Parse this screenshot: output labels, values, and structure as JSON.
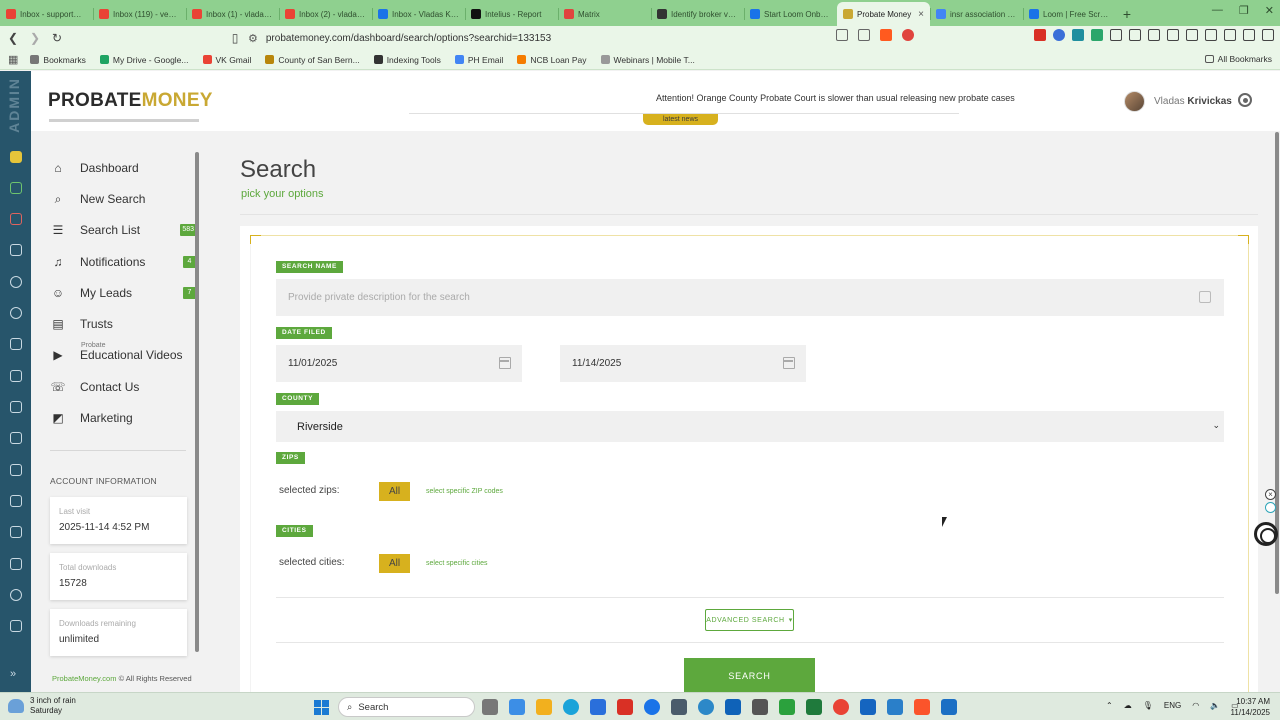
{
  "browser": {
    "tabs": [
      {
        "title": "Inbox - support@...",
        "color": "#ea4335"
      },
      {
        "title": "Inbox (119) - vee@...",
        "color": "#ea4335"
      },
      {
        "title": "Inbox (1) - vladas@...",
        "color": "#ea4335"
      },
      {
        "title": "Inbox (2) - vladas...",
        "color": "#ea4335"
      },
      {
        "title": "Inbox - Vladas Kriv...",
        "color": "#1a73e8"
      },
      {
        "title": "Intelius - Report",
        "color": "#111111"
      },
      {
        "title": "Matrix",
        "color": "#e0443e"
      },
      {
        "title": "Identify broker vs...",
        "color": "#333333"
      },
      {
        "title": "Start Loom Onboa...",
        "color": "#1a73e8"
      },
      {
        "title": "Probate Money",
        "color": "#c9a833",
        "active": true
      },
      {
        "title": "insr association of...",
        "color": "#4285f4"
      },
      {
        "title": "Loom | Free Scree...",
        "color": "#1a73e8"
      }
    ],
    "url": "probatemoney.com/dashboard/search/options?searchid=133153",
    "bookmarks": [
      {
        "label": "Bookmarks",
        "color": "#777777"
      },
      {
        "label": "My Drive - Google...",
        "color": "#1fa463"
      },
      {
        "label": "VK Gmail",
        "color": "#ea4335"
      },
      {
        "label": "County of San Bern...",
        "color": "#b8860b"
      },
      {
        "label": "Indexing Tools",
        "color": "#333333"
      },
      {
        "label": "PH Email",
        "color": "#4285f4"
      },
      {
        "label": "NCB Loan Pay",
        "color": "#f57c00"
      },
      {
        "label": "Webinars | Mobile T...",
        "color": "#999999"
      }
    ],
    "all_bookmarks": "All Bookmarks"
  },
  "rail": {
    "label": "ADMIN"
  },
  "header": {
    "logo_part1": "PROBATE",
    "logo_part2": "MONEY",
    "news_text": "Attention! Orange County Probate Court is slower than usual releasing new probate cases",
    "news_tag": "latest news",
    "user_first": "Vladas",
    "user_last": "Krivickas"
  },
  "sidebar": {
    "items": [
      {
        "label": "Dashboard",
        "icon": "home-icon"
      },
      {
        "label": "New Search",
        "icon": "search-icon"
      },
      {
        "label": "Search List",
        "icon": "list-icon",
        "badge": "583"
      },
      {
        "label": "Notifications",
        "icon": "bell-icon",
        "badge": "4"
      },
      {
        "label": "My Leads",
        "icon": "person-icon",
        "badge": "7"
      },
      {
        "label": "Trusts",
        "icon": "document-icon"
      },
      {
        "label": "Educational Videos",
        "icon": "play-icon",
        "small": "Probate"
      },
      {
        "label": "Contact Us",
        "icon": "chat-icon"
      },
      {
        "label": "Marketing",
        "icon": "megaphone-icon"
      }
    ],
    "account_title": "ACCOUNT INFORMATION",
    "account": [
      {
        "label": "Last visit",
        "value": "2025-11-14 4:52 PM"
      },
      {
        "label": "Total downloads",
        "value": "15728"
      },
      {
        "label": "Downloads remaining",
        "value": "unlimited"
      }
    ],
    "copyright_site": "ProbateMoney.com",
    "copyright_rest": " © All Rights Reserved"
  },
  "main": {
    "title": "Search",
    "subtitle": "pick your options",
    "search_name_tag": "SEARCH NAME",
    "search_name_placeholder": "Provide private description for the search",
    "date_tag": "DATE FILED",
    "date_from": "11/01/2025",
    "date_to": "11/14/2025",
    "county_tag": "COUNTY",
    "county_value": "Riverside",
    "zips_tag": "ZIPS",
    "zips_label": "selected zips:",
    "zips_all": "All",
    "zips_link": "select specific ZIP codes",
    "cities_tag": "CITIES",
    "cities_label": "selected cities:",
    "cities_all": "All",
    "cities_link": "select specific cities",
    "advanced_label": "ADVANCED SEARCH",
    "search_label": "SEARCH"
  },
  "taskbar": {
    "weather_line1": "3 inch of rain",
    "weather_line2": "Saturday",
    "search": "Search",
    "lang": "ENG",
    "time": "10:37 AM",
    "date": "11/14/2025"
  }
}
